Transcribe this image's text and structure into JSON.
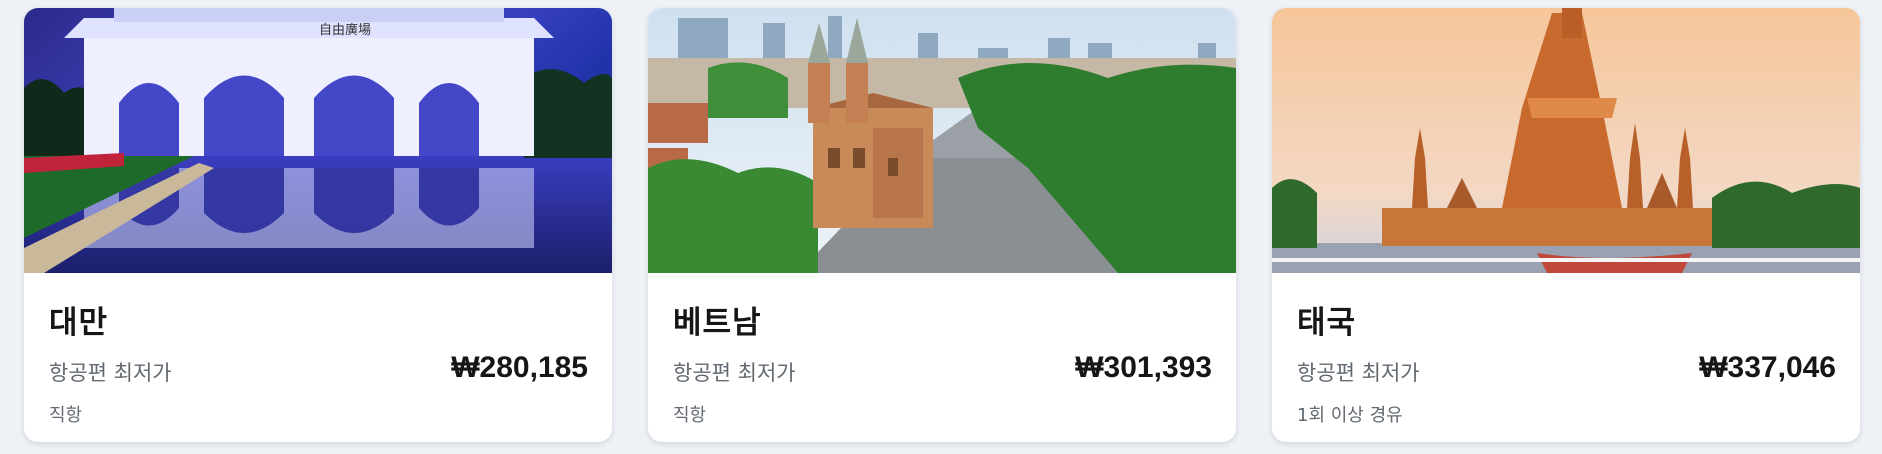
{
  "destinations": [
    {
      "name": "대만",
      "price_label": "항공편 최저가",
      "price": "₩280,185",
      "route_type": "직항",
      "image_text": "自由廣場"
    },
    {
      "name": "베트남",
      "price_label": "항공편 최저가",
      "price": "₩301,393",
      "route_type": "직항"
    },
    {
      "name": "태국",
      "price_label": "항공편 최저가",
      "price": "₩337,046",
      "route_type": "1회 이상 경유"
    }
  ]
}
